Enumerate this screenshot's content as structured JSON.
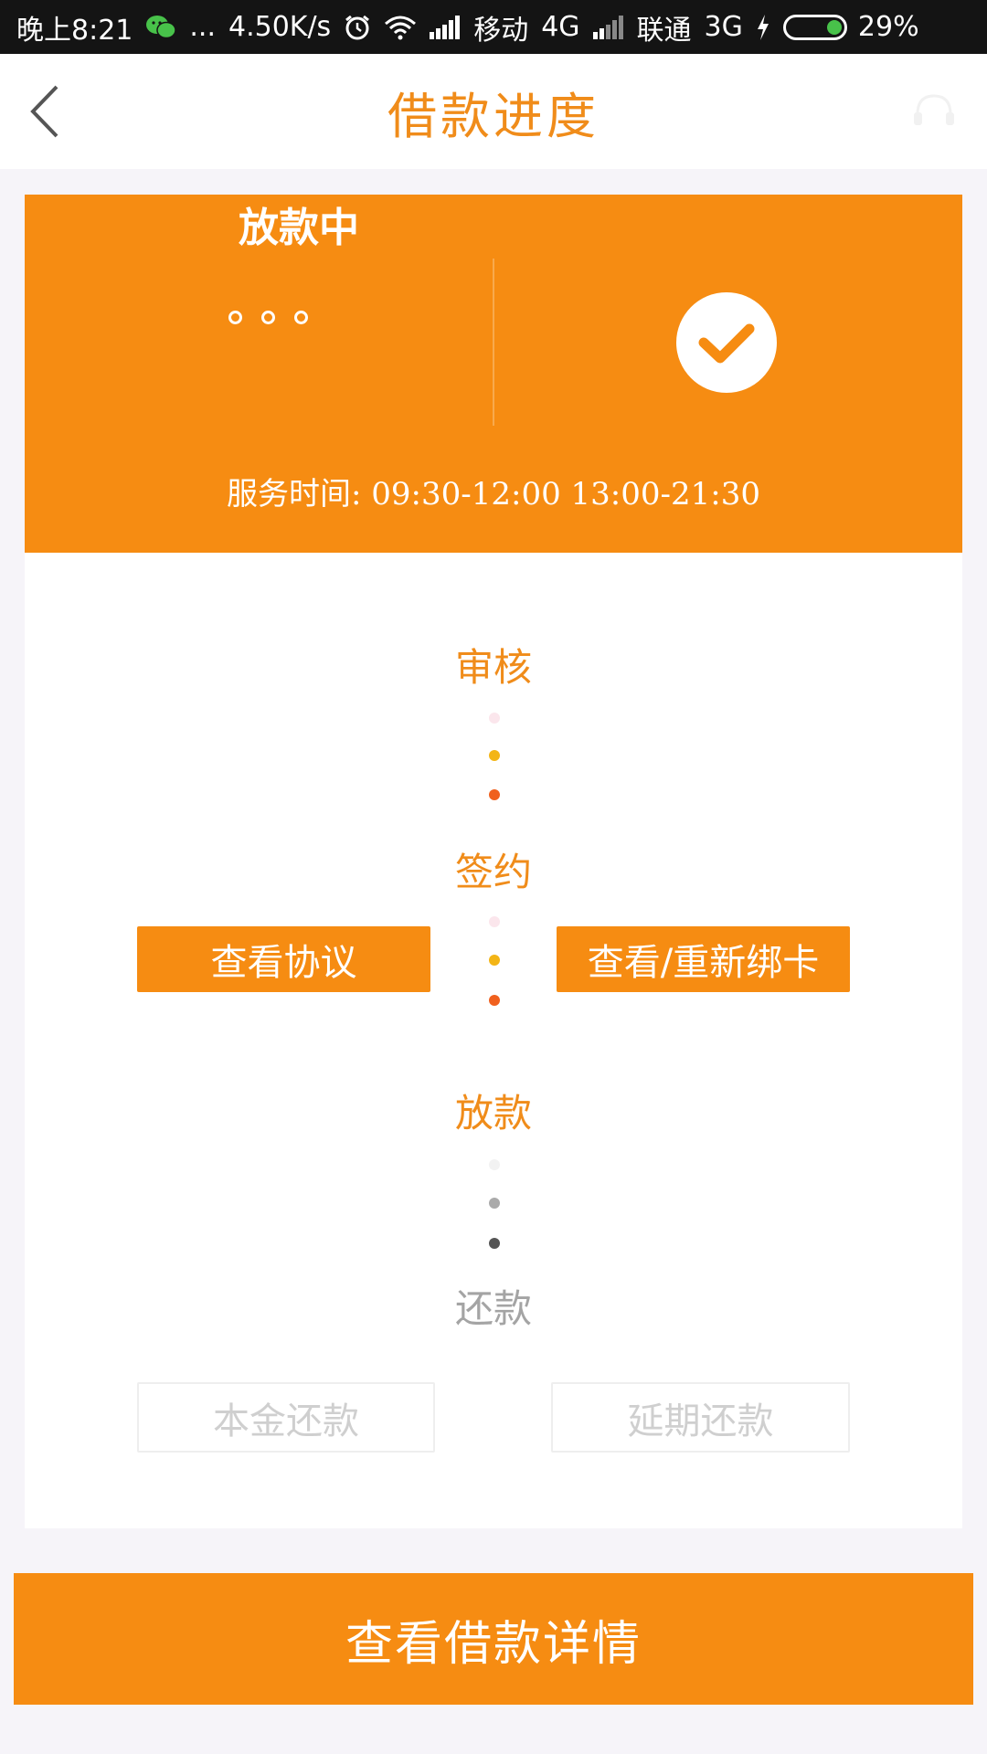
{
  "status_bar": {
    "time": "晚上8:21",
    "more": "...",
    "speed": "4.50K/s",
    "carrier1": "移动",
    "net1": "4G",
    "carrier2": "联通",
    "net2": "3G",
    "battery": "29%"
  },
  "header": {
    "title": "借款进度",
    "back_icon": "chevron-left-icon",
    "right_icon": "headset-icon"
  },
  "status_card": {
    "status": "放款中",
    "service_time": "服务时间: 09:30-12:00 13:00-21:30",
    "check_icon": "check-circle-icon"
  },
  "progress": {
    "steps": [
      {
        "label": "审核",
        "active": true
      },
      {
        "label": "签约",
        "active": true
      },
      {
        "label": "放款",
        "active": true
      },
      {
        "label": "还款",
        "active": false
      }
    ],
    "buttons": {
      "view_agreement": "查看协议",
      "view_rebind_card": "查看/重新绑卡",
      "principal_repay": "本金还款",
      "deferred_repay": "延期还款"
    }
  },
  "bottom_button": "查看借款详情",
  "colors": {
    "accent": "#f68c12",
    "title": "#f08c1a",
    "inactive": "#a4a4a4"
  }
}
